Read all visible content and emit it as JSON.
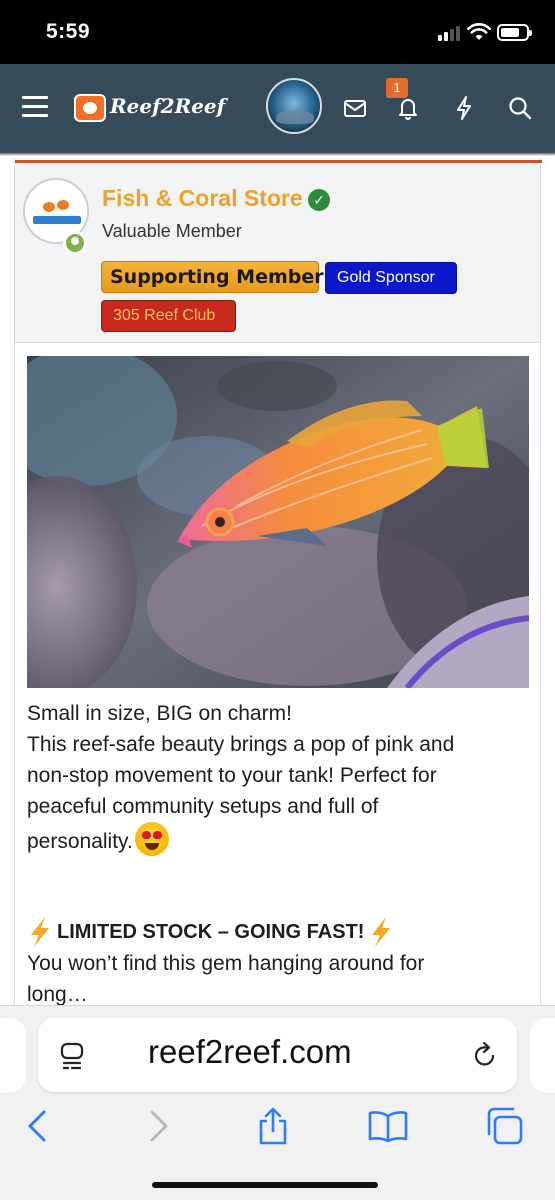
{
  "status_bar": {
    "time": "5:59"
  },
  "header": {
    "logo_text": "Reef2Reef",
    "notification_count": "1",
    "icons": [
      "menu-icon",
      "reef2reef-logo",
      "avatar",
      "inbox-icon",
      "bell-icon",
      "bolt-icon",
      "search-icon"
    ]
  },
  "post": {
    "author": {
      "name": "Fish & Coral Store",
      "title": "Valuable Member",
      "verified": true,
      "online": true
    },
    "banners": [
      {
        "label": "Supporting Member",
        "color": "#f0a92a"
      },
      {
        "label": "Gold Sponsor",
        "color": "#0b18c9"
      },
      {
        "label": "305 Reef Club",
        "color": "#c7291c"
      }
    ],
    "body_lines": [
      "Small in size, BIG on charm!",
      "This reef-safe beauty brings a pop of pink and",
      "non-stop movement to your tank! Perfect for",
      "peaceful community setups and full of",
      "personality."
    ],
    "emoji": "heart-eyes-emoji",
    "limited_heading": "LIMITED STOCK – GOING FAST!",
    "limited_lines": [
      "You won’t find this gem hanging around for",
      "long…"
    ]
  },
  "browser": {
    "url": "reef2reef.com",
    "toolbar": [
      "back-icon",
      "forward-icon",
      "share-icon",
      "bookmarks-icon",
      "tabs-icon"
    ]
  },
  "colors": {
    "header_bg": "#364b5a",
    "username": "#f0a12a",
    "accent": "#c9562a"
  }
}
